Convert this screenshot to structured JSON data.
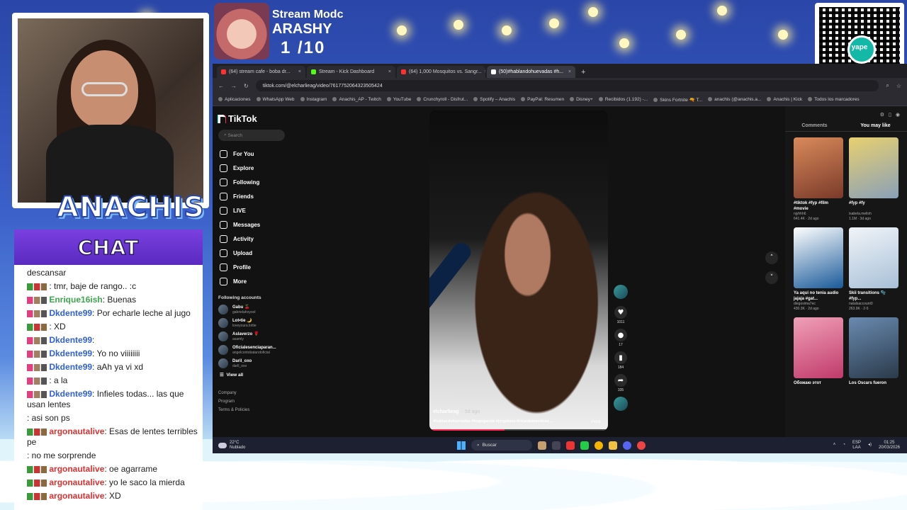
{
  "overlay": {
    "stream_mode": "Stream Modc",
    "streamer_name": "ARASHY",
    "counter": "1 /10",
    "brand": "ANACHIS",
    "qr_label": "yape"
  },
  "chat": {
    "header": "CHAT",
    "messages": [
      {
        "user": "",
        "text": "descansar",
        "badge": "none",
        "color": "#222"
      },
      {
        "user": "",
        "text": ": tmr, baje de rango.. :c",
        "badge": "green",
        "color": "#e03030"
      },
      {
        "user": "Enrique16ish",
        "text": ": Buenas",
        "badge": "pink",
        "color": "#3aa84a"
      },
      {
        "user": "Dkdente99",
        "text": ": Por echarle leche al jugo",
        "badge": "pink",
        "color": "#3060e0"
      },
      {
        "user": "",
        "text": ": XD",
        "badge": "green",
        "color": "#e03030"
      },
      {
        "user": "Dkdente99",
        "text": ":",
        "badge": "pink",
        "color": "#3060e0"
      },
      {
        "user": "Dkdente99",
        "text": ": Yo no viiiiiiii",
        "badge": "pink",
        "color": "#3060e0"
      },
      {
        "user": "Dkdente99",
        "text": ": aAh ya vi xd",
        "badge": "pink",
        "color": "#3060e0"
      },
      {
        "user": "",
        "text": ": a la",
        "badge": "pink",
        "color": "#3aa84a"
      },
      {
        "user": "Dkdente99",
        "text": ": Infieles todas... las que usan lentes",
        "badge": "pink",
        "color": "#3060e0"
      },
      {
        "user": "",
        "text": ": asi son ps",
        "badge": "none",
        "color": "#3060e0"
      },
      {
        "user": "argonautalive",
        "text": ": Esas de lentes terribles pe",
        "badge": "green",
        "color": "#e03030"
      },
      {
        "user": "",
        "text": ": no me sorprende",
        "badge": "none",
        "color": "#3060e0"
      },
      {
        "user": "argonautalive",
        "text": ": oe agarrame",
        "badge": "green",
        "color": "#e03030"
      },
      {
        "user": "argonautalive",
        "text": ": yo le saco la mierda",
        "badge": "green",
        "color": "#e03030"
      },
      {
        "user": "argonautalive",
        "text": ": XD",
        "badge": "green",
        "color": "#e03030"
      }
    ]
  },
  "browser": {
    "tabs": [
      {
        "label": "(64) stream cafe - boba dr...",
        "icon_color": "#ff3030",
        "active": false
      },
      {
        "label": "Stream - Kick Dashboard",
        "icon_color": "#53fc18",
        "active": false
      },
      {
        "label": "(64) 1,000 Mosquitos vs. Sangr...",
        "icon_color": "#ff3030",
        "active": false
      },
      {
        "label": "(50)#hablandohuevadas #h...",
        "icon_color": "#ffffff",
        "active": true
      }
    ],
    "url": "tiktok.com/@elcharlieag/video/7617752064323505424",
    "bookmarks": [
      "Aplicaciones",
      "WhatsApp Web",
      "Instagram",
      "Anachis_AP - Twitch",
      "YouTube",
      "Crunchyroll - Disfrut...",
      "Spotify – Anachis",
      "PayPal: Resumen",
      "Disney+",
      "Recibidos (1.192) -...",
      "Skins Fortnite 🔫 T...",
      "anachis (@anachis.a...",
      "Anachis | Kick",
      "Todos los marcadores"
    ]
  },
  "tiktok": {
    "logo": "TikTok",
    "search_placeholder": "Search",
    "nav": [
      {
        "label": "For You",
        "icon": "home-icon"
      },
      {
        "label": "Explore",
        "icon": "compass-icon"
      },
      {
        "label": "Following",
        "icon": "following-icon"
      },
      {
        "label": "Friends",
        "icon": "friends-icon"
      },
      {
        "label": "LIVE",
        "icon": "live-icon"
      },
      {
        "label": "Messages",
        "icon": "messages-icon"
      },
      {
        "label": "Activity",
        "icon": "activity-icon"
      },
      {
        "label": "Upload",
        "icon": "upload-icon"
      },
      {
        "label": "Profile",
        "icon": "profile-icon"
      },
      {
        "label": "More",
        "icon": "more-icon"
      }
    ],
    "following_title": "Following accounts",
    "accounts": [
      {
        "name": "Gabu 🍒",
        "handle": "gabrielahoyool"
      },
      {
        "name": "Lot•tie 🌙",
        "handle": "loveyoura.lottie"
      },
      {
        "name": "Aslaverzo 🌹",
        "handle": "asamly"
      },
      {
        "name": "Oficialesenciaparan...",
        "handle": "angelcontobatarotoficial"
      },
      {
        "name": "Daril_oxo",
        "handle": "darll_oxo"
      }
    ],
    "view_all": "View all",
    "footer": [
      "Company",
      "Program",
      "Terms & Policies"
    ],
    "video": {
      "user": "elcharlieag",
      "age": "· 5d ago",
      "tags": "#hablandohuevadas #hugogarcia #jorgeluna #ricardomendoza ...",
      "more": "more",
      "progress": 0.42
    },
    "actions": [
      {
        "icon": "heart-icon",
        "glyph": "♥",
        "count": "1011"
      },
      {
        "icon": "comment-icon",
        "glyph": "●",
        "count": "17"
      },
      {
        "icon": "bookmark-icon",
        "glyph": "▮",
        "count": "184"
      },
      {
        "icon": "share-icon",
        "glyph": "➦",
        "count": "335"
      }
    ],
    "right_tabs": [
      "Comments",
      "You may like"
    ],
    "suggested": [
      {
        "title": "#tiktok #fyp #film #movie",
        "author": "njyhhh6",
        "meta": "641.4K · 2d ago",
        "c1": "#d98a5a",
        "c2": "#7a3a2a"
      },
      {
        "title": "#fyp #fy",
        "author": "isabela.melloh",
        "meta": "1.1M · 3d ago",
        "c1": "#e8d070",
        "c2": "#8aa0b8"
      },
      {
        "title": "Ya aqui no tenia audio jajaja #gat...",
        "author": "diegosima7ec",
        "meta": "430.3K · 2d ago",
        "c1": "#ffffff",
        "c2": "#1a5a9a"
      },
      {
        "title": "Skii transitions 🫧 #fyp...",
        "author": "natalsaccount0",
        "meta": "263.9K · 2-5",
        "c1": "#f0f4f8",
        "c2": "#a8c0d8"
      },
      {
        "title": "Обожаю этот",
        "author": "",
        "meta": "",
        "c1": "#f0a0b8",
        "c2": "#c03a6a"
      },
      {
        "title": "Los Oscars fueron",
        "author": "",
        "meta": "",
        "c1": "#6a8ab0",
        "c2": "#2a3a4a"
      }
    ]
  },
  "taskbar": {
    "temp": "22°C",
    "weather": "Nublado",
    "search": "Buscar",
    "lang": "ESP",
    "lang2": "LAA",
    "time": "01:25",
    "date": "20/03/2026"
  },
  "colors": {
    "accent": "#fe2c55",
    "tiktok_cyan": "#25f4ee",
    "chat_header": "#6a34d0"
  }
}
